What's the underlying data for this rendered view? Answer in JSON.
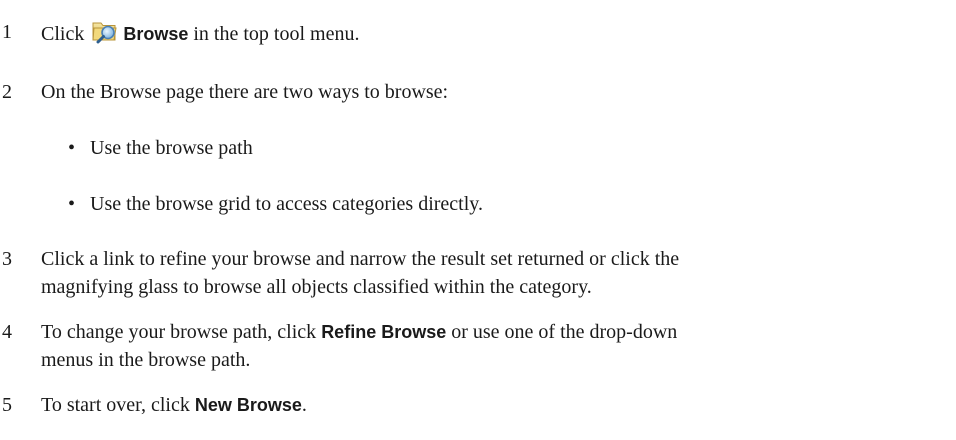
{
  "steps": [
    {
      "number": "1",
      "before": "Click ",
      "icon": "browse-folder-magnifier-icon",
      "ui_label": "Browse",
      "after": " in the top tool menu."
    },
    {
      "number": "2",
      "text": "On the Browse page there are two ways to browse:"
    },
    {
      "number": "3",
      "line1": "Click a link to refine your browse and narrow the result set returned or click the",
      "line2": "magnifying glass to browse all objects classified within the category."
    },
    {
      "number": "4",
      "before": "To change your browse path, click ",
      "ui_label": "Refine Browse",
      "after": " or use one of the drop-down",
      "line2": "menus in the browse path."
    },
    {
      "number": "5",
      "before": "To start over, click ",
      "ui_label": "New Browse",
      "after": "."
    }
  ],
  "bullets": [
    "Use the browse path",
    "Use the browse grid to access categories directly."
  ],
  "bullet_glyph": "•"
}
